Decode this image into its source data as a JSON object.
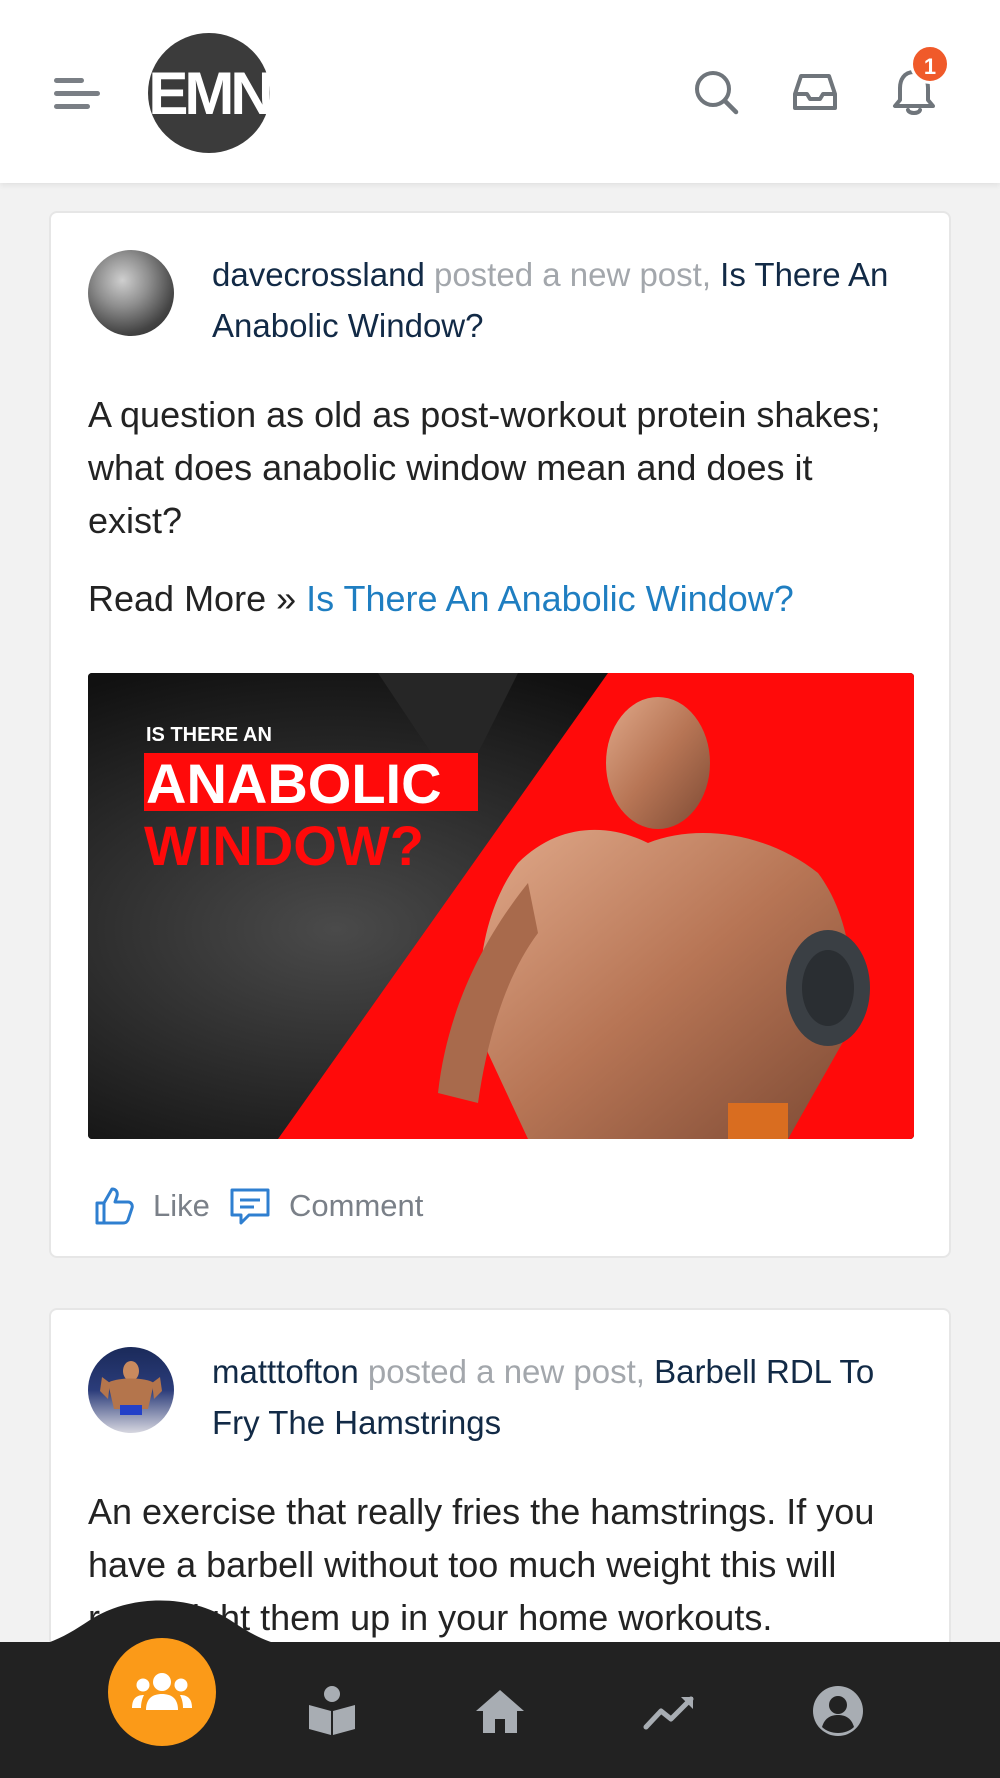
{
  "header": {
    "logo_text": "EMN",
    "notification_count": "1"
  },
  "posts": [
    {
      "user": "davecrossland",
      "action": "posted a new post,",
      "title": "Is There An Anabolic Window?",
      "body": "A question as old as post-workout protein shakes; what does anabolic window mean and does it exist?",
      "read_more_label": "Read More »",
      "read_more_link": "Is There An Anabolic Window?",
      "image_text_small": "IS THERE AN",
      "image_text_highlight": "ANABOLIC",
      "image_text_red": "WINDOW?",
      "like_label": "Like",
      "comment_label": "Comment"
    },
    {
      "user": "matttofton",
      "action": "posted a new post,",
      "title": "Barbell RDL To Fry The Hamstrings",
      "body": "An exercise that really fries the hamstrings. If you have a barbell without too much weight this will really light them up in your home workouts."
    }
  ],
  "bottom_nav": {
    "items": [
      "community-icon",
      "reader-icon",
      "home-icon",
      "stats-icon",
      "profile-icon"
    ],
    "active": "community-icon",
    "accent_color": "#fb9a18"
  }
}
